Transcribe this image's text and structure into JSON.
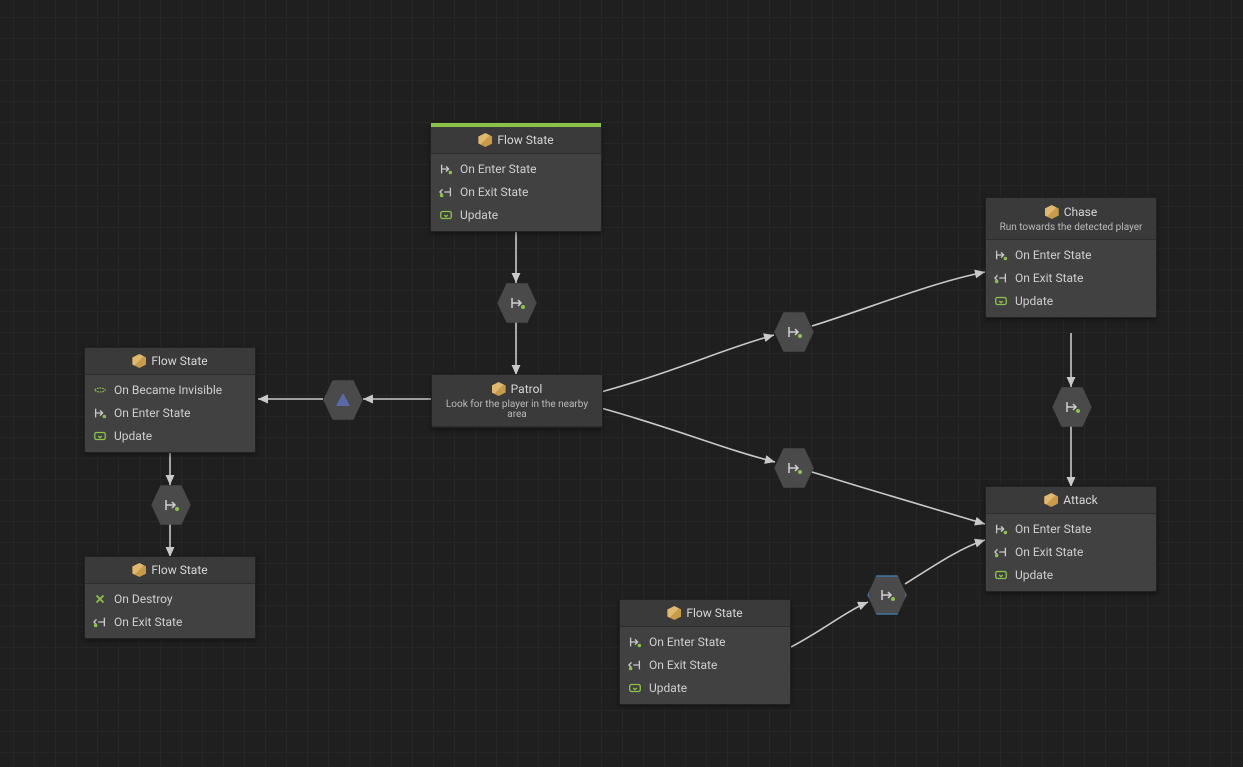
{
  "nodes": {
    "n_start": {
      "title": "Flow State",
      "subtitle": "",
      "events": [
        "On Enter State",
        "On Exit State",
        "Update"
      ]
    },
    "n_patrol": {
      "title": "Patrol",
      "subtitle": "Look for the player in the nearby area",
      "events": []
    },
    "n_chase": {
      "title": "Chase",
      "subtitle": "Run towards the detected player",
      "events": [
        "On Enter State",
        "On Exit State",
        "Update"
      ]
    },
    "n_attack": {
      "title": "Attack",
      "subtitle": "",
      "events": [
        "On Enter State",
        "On Exit State",
        "Update"
      ]
    },
    "n_left1": {
      "title": "Flow State",
      "subtitle": "",
      "events": [
        "On Became Invisible",
        "On Enter State",
        "Update"
      ]
    },
    "n_left2": {
      "title": "Flow State",
      "subtitle": "",
      "events": [
        "On Destroy",
        "On Exit State"
      ]
    },
    "n_bottom": {
      "title": "Flow State",
      "subtitle": "",
      "events": [
        "On Enter State",
        "On Exit State",
        "Update"
      ]
    }
  },
  "icons": {
    "enter": "On Enter State",
    "exit": "On Exit State",
    "update": "Update",
    "invisible": "On Became Invisible",
    "destroy": "On Destroy"
  }
}
